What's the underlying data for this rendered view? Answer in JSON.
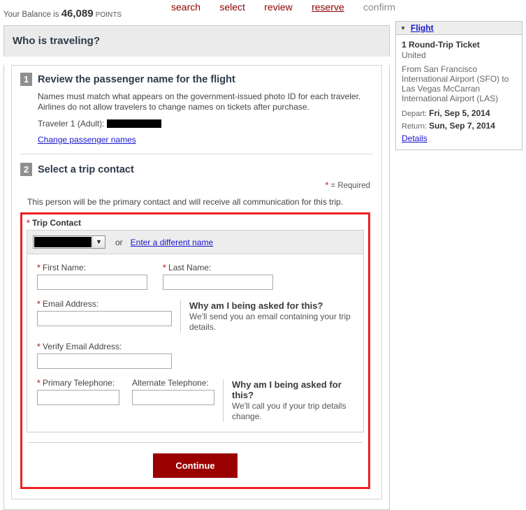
{
  "topbar": {
    "balance_prefix": "Your Balance is",
    "balance_amount": "46,089",
    "balance_unit": "POINTS",
    "steps": [
      {
        "label": "search",
        "state": "link"
      },
      {
        "label": "select",
        "state": "link"
      },
      {
        "label": "review",
        "state": "link"
      },
      {
        "label": "reserve",
        "state": "active"
      },
      {
        "label": "confirm",
        "state": "done"
      }
    ]
  },
  "page": {
    "title": "Who is traveling?"
  },
  "section1": {
    "number": "1",
    "heading": "Review the passenger name for the flight",
    "note": "Names must match what appears on the government-issued photo ID for each traveler. Airlines do not allow travelers to change names on tickets after purchase.",
    "traveler_label": "Traveler 1 (Adult):",
    "traveler_value": "",
    "change_link": "Change passenger names"
  },
  "section2": {
    "number": "2",
    "heading": "Select a trip contact",
    "required_star": "*",
    "required_text": "= Required",
    "intro": "This person will be the primary contact and will receive all communication for this trip.",
    "fieldset_legend": "Trip Contact",
    "select_value": "",
    "or_text": "or",
    "different_name_link": "Enter a different name",
    "fields": {
      "first_name": {
        "label": "First Name:",
        "value": "",
        "required": true
      },
      "last_name": {
        "label": "Last Name:",
        "value": "",
        "required": true
      },
      "email": {
        "label": "Email Address:",
        "value": "",
        "required": true
      },
      "verify_email": {
        "label": "Verify Email Address:",
        "value": "",
        "required": true
      },
      "primary_phone": {
        "label": "Primary Telephone:",
        "value": "",
        "required": true
      },
      "alternate_phone": {
        "label": "Alternate Telephone:",
        "value": "",
        "required": false
      }
    },
    "why_email": {
      "heading": "Why am I being asked for this?",
      "text": "We'll send you an email containing your trip details."
    },
    "why_phone": {
      "heading": "Why am I being asked for this?",
      "text": "We'll call you if your trip details change."
    },
    "continue_label": "Continue"
  },
  "sidebar": {
    "panel_title": "Flight",
    "ticket_summary": "1 Round-Trip Ticket",
    "airline": "United",
    "route": "From San Francisco International Airport (SFO) to Las Vegas McCarran International Airport (LAS)",
    "depart_label": "Depart:",
    "depart_value": "Fri, Sep 5, 2014",
    "return_label": "Return:",
    "return_value": "Sun, Sep 7, 2014",
    "details_link": "Details"
  },
  "colors": {
    "step_link": "#8c0000",
    "step_done": "#8c8c8c",
    "link": "#1717d0",
    "highlight_border": "#ee2222",
    "continue_bg": "#9b0000",
    "required_star": "#d24a4a"
  }
}
